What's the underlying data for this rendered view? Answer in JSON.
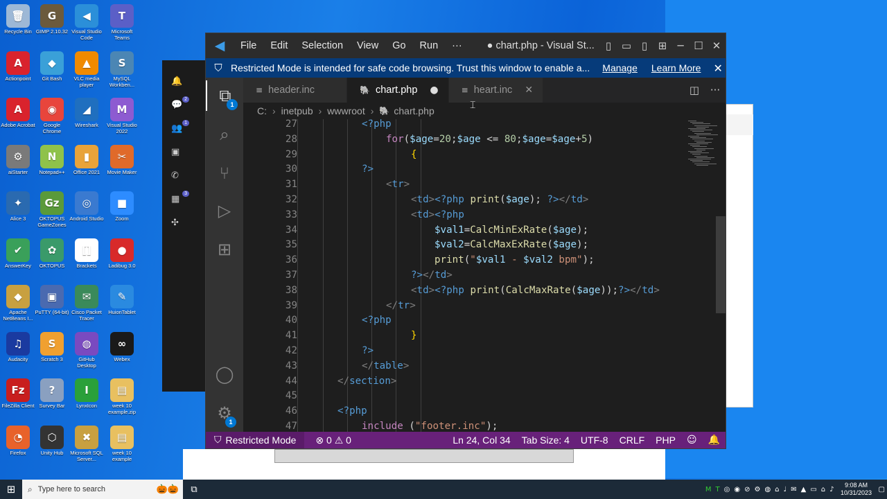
{
  "desktop": {
    "icons": [
      {
        "label": "Recycle Bin",
        "icon": "recycle-bin-icon",
        "color": "#9db8d6",
        "glyph": "🗑"
      },
      {
        "label": "GIMP 2.10.32",
        "icon": "gimp-icon",
        "color": "#6b5a3c",
        "glyph": "G"
      },
      {
        "label": "Visual Studio Code",
        "icon": "vscode-icon",
        "color": "#2b8fd9",
        "glyph": "◀"
      },
      {
        "label": "Microsoft Teams",
        "icon": "teams-icon",
        "color": "#5b5fc7",
        "glyph": "T"
      },
      {
        "label": "Actionpoint",
        "icon": "actionpoint-icon",
        "color": "#d9232d",
        "glyph": "A"
      },
      {
        "label": "Git Bash",
        "icon": "git-bash-icon",
        "color": "#3aa0d8",
        "glyph": "◆"
      },
      {
        "label": "VLC media player",
        "icon": "vlc-icon",
        "color": "#f08a00",
        "glyph": "▲"
      },
      {
        "label": "MySQL Workben...",
        "icon": "mysql-workbench-icon",
        "color": "#4b86b4",
        "glyph": "S"
      },
      {
        "label": "Adobe Acrobat",
        "icon": "acrobat-icon",
        "color": "#d9232d",
        "glyph": "A"
      },
      {
        "label": "Google Chrome",
        "icon": "chrome-icon",
        "color": "#e8453c",
        "glyph": "◉"
      },
      {
        "label": "Wireshark",
        "icon": "wireshark-icon",
        "color": "#1f6fbf",
        "glyph": "◢"
      },
      {
        "label": "Visual Studio 2022",
        "icon": "visual-studio-icon",
        "color": "#8d5bd1",
        "glyph": "M"
      },
      {
        "label": "aiStarter",
        "icon": "aistarter-icon",
        "color": "#7a7a7a",
        "glyph": "⚙"
      },
      {
        "label": "Notepad++",
        "icon": "notepadpp-icon",
        "color": "#8fc24a",
        "glyph": "N"
      },
      {
        "label": "Office 2021",
        "icon": "office-icon",
        "color": "#e8a33a",
        "glyph": "▮"
      },
      {
        "label": "Movie Maker",
        "icon": "movie-maker-icon",
        "color": "#e06a2a",
        "glyph": "✂"
      },
      {
        "label": "Alice 3",
        "icon": "alice-icon",
        "color": "#2a6ab0",
        "glyph": "✦"
      },
      {
        "label": "OKTOPUS GameZones",
        "icon": "oktopus-gamezones-icon",
        "color": "#5a9a3a",
        "glyph": "Gz"
      },
      {
        "label": "Android Studio",
        "icon": "android-studio-icon",
        "color": "#3a7ad0",
        "glyph": "◎"
      },
      {
        "label": "Zoom",
        "icon": "zoom-icon",
        "color": "#2d8cff",
        "glyph": "■"
      },
      {
        "label": "AnswerKey",
        "icon": "answerkey-icon",
        "color": "#3aa05a",
        "glyph": "✔"
      },
      {
        "label": "OKTOPUS",
        "icon": "oktopus-icon",
        "color": "#3a9a6a",
        "glyph": "✿"
      },
      {
        "label": "Brackets",
        "icon": "brackets-icon",
        "color": "#ffffff",
        "glyph": "[]"
      },
      {
        "label": "Ladibug 3.0",
        "icon": "ladibug-icon",
        "color": "#d82a2a",
        "glyph": "●"
      },
      {
        "label": "Apache NetBeans I...",
        "icon": "netbeans-icon",
        "color": "#c8a040",
        "glyph": "◆"
      },
      {
        "label": "PuTTY (64-bit)",
        "icon": "putty-icon",
        "color": "#4a6ab0",
        "glyph": "▣"
      },
      {
        "label": "Cisco Packet Tracer",
        "icon": "packet-tracer-icon",
        "color": "#3a8a5a",
        "glyph": "✉"
      },
      {
        "label": "HuionTablet",
        "icon": "huion-icon",
        "color": "#2a8ae0",
        "glyph": "✎"
      },
      {
        "label": "Audacity",
        "icon": "audacity-icon",
        "color": "#1a3aa0",
        "glyph": "♫"
      },
      {
        "label": "Scratch 3",
        "icon": "scratch-icon",
        "color": "#f0a030",
        "glyph": "S"
      },
      {
        "label": "GitHub Desktop",
        "icon": "github-desktop-icon",
        "color": "#7a4ac0",
        "glyph": "◍"
      },
      {
        "label": "Webex",
        "icon": "webex-icon",
        "color": "#1a1a1a",
        "glyph": "∞"
      },
      {
        "label": "FileZilla Client",
        "icon": "filezilla-icon",
        "color": "#c81e1e",
        "glyph": "Fz"
      },
      {
        "label": "Survey Bar",
        "icon": "survey-bar-icon",
        "color": "#8aa0c0",
        "glyph": "?"
      },
      {
        "label": "LynxIcon",
        "icon": "lynxicon-icon",
        "color": "#2aa03a",
        "glyph": "I"
      },
      {
        "label": "week 10 example.zip",
        "icon": "zip-folder-icon",
        "color": "#e8c060",
        "glyph": "▤"
      },
      {
        "label": "Firefox",
        "icon": "firefox-icon",
        "color": "#e8622a",
        "glyph": "◔"
      },
      {
        "label": "Unity Hub",
        "icon": "unity-hub-icon",
        "color": "#333333",
        "glyph": "⬡"
      },
      {
        "label": "Microsoft SQL Server...",
        "icon": "sql-server-icon",
        "color": "#c8a040",
        "glyph": "✖"
      },
      {
        "label": "week 10 example",
        "icon": "folder-icon",
        "color": "#e8c060",
        "glyph": "▤"
      }
    ]
  },
  "teams": {
    "badge_chat": "2",
    "badge_teams": "1",
    "badge_calendar": "3"
  },
  "vscode": {
    "menu": [
      "File",
      "Edit",
      "Selection",
      "View",
      "Go",
      "Run"
    ],
    "more": "···",
    "title": "● chart.php - Visual St...",
    "banner": {
      "text": "Restricted Mode is intended for safe code browsing. Trust this window to enable a...",
      "manage": "Manage",
      "learn_more": "Learn More"
    },
    "explorer_badge": "1",
    "manage_badge": "1",
    "tabs": [
      {
        "label": "header.inc",
        "icon": "file-lines-icon",
        "active": false
      },
      {
        "label": "chart.php",
        "icon": "php-elephant-icon",
        "active": true,
        "modified": true
      },
      {
        "label": "heart.inc",
        "icon": "file-lines-icon",
        "active": false
      }
    ],
    "breadcrumb": [
      "C:",
      "inetpub",
      "wwwroot",
      "chart.php"
    ],
    "status": {
      "restricted": "Restricted Mode",
      "problems": "⊗ 0 ⚠ 0",
      "position": "Ln 24, Col 34",
      "tab_size": "Tab Size: 4",
      "encoding": "UTF-8",
      "eol": "CRLF",
      "language": "PHP"
    }
  },
  "taskbar": {
    "search_placeholder": "Type here to search",
    "time": "9:08 AM",
    "date": "10/31/2023"
  }
}
